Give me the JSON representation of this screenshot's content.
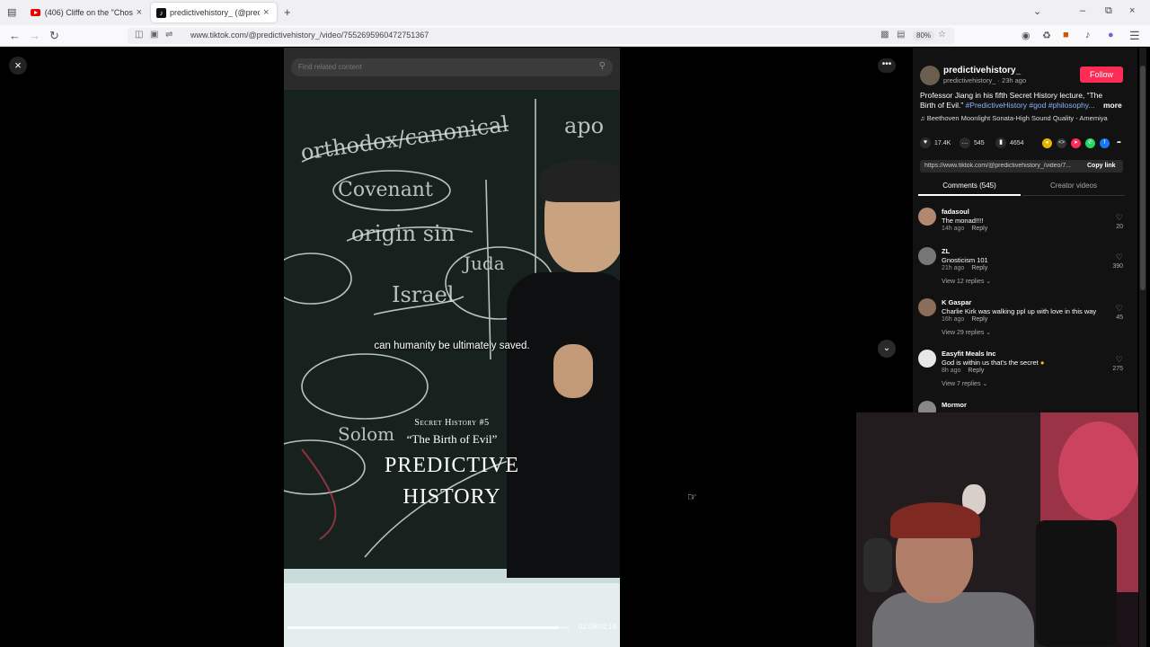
{
  "browser": {
    "tabs": [
      {
        "title": "(406) Cliffe on the \"Chosen Peo",
        "favicon": "youtube-icon",
        "active": false
      },
      {
        "title": "predictivehistory_ (@predic",
        "favicon": "tiktok-icon",
        "active": true
      }
    ],
    "new_tab": "+",
    "url": "www.tiktok.com/@predictivehistory_/video/7552695960472751367",
    "zoom": "80%"
  },
  "video": {
    "search_placeholder": "Find related content",
    "subtitle": "can humanity be ultimately saved.",
    "series_label": "Secret History #5",
    "episode_title": "“The Birth of Evil”",
    "brand_line1": "PREDICTIVE",
    "brand_line2": "HISTORY",
    "time": "02:09/02:14",
    "progress": 0.963
  },
  "post": {
    "author_name": "predictivehistory_",
    "author_meta": "predictivehistory_ · 23h ago",
    "follow_label": "Follow",
    "description": "Professor Jiang in his fifth Secret History lecture, “The Birth of Evil.”",
    "tags": "#PredictiveHistory #god #philosophy...",
    "more_label": "more",
    "music": "Beethoven Moonlight Sonata-High Sound Quality - Amemiya",
    "likes": "17.4K",
    "comments": "545",
    "saves": "4654",
    "copy_url": "https://www.tiktok.com/@predictivehistory_/video/7...",
    "copy_label": "Copy link"
  },
  "tabs": {
    "comments": "Comments (545)",
    "creator": "Creator videos"
  },
  "comments": [
    {
      "user": "fadasoul",
      "text": "The monad!!!!",
      "time": "14h ago",
      "reply": "Reply",
      "likes": "20",
      "replies": ""
    },
    {
      "user": "ZL",
      "text": "Gnosticism 101",
      "time": "21h ago",
      "reply": "Reply",
      "likes": "390",
      "replies": "View 12 replies"
    },
    {
      "user": "K Gaspar",
      "text": "Charlie Kirk was walking ppl up with love in this way",
      "time": "16h ago",
      "reply": "Reply",
      "likes": "45",
      "replies": "View 29 replies"
    },
    {
      "user": "Easyfit Meals Inc",
      "text": "God is within us that's the secret",
      "time": "8h ago",
      "reply": "Reply",
      "likes": "275",
      "replies": "View 7 replies"
    },
    {
      "user": "Mormor",
      "text": "",
      "time": "",
      "reply": "",
      "likes": "",
      "replies": ""
    }
  ],
  "colors": {
    "follow": "#fe2c55",
    "tags": "#8ab4f8"
  }
}
